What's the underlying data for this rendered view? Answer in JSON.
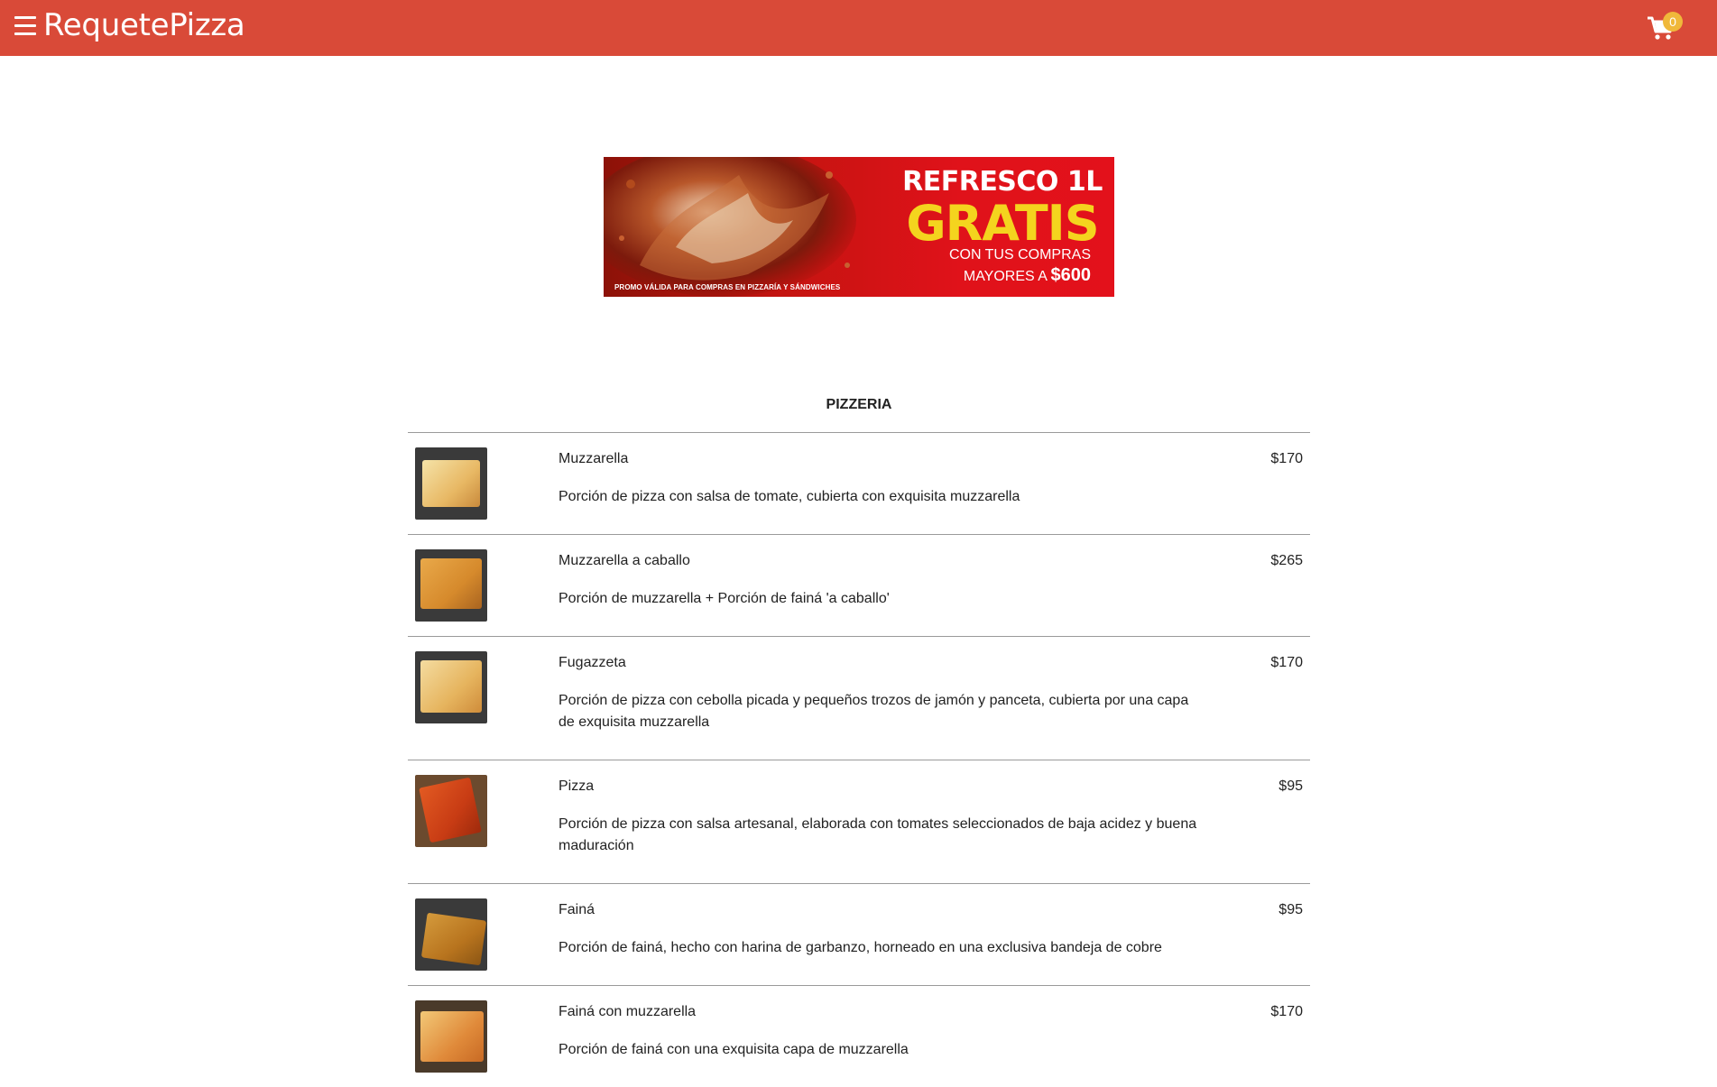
{
  "header": {
    "brand": "RequetePizza",
    "cart_count": "0",
    "colors": {
      "bar": "#d94a38",
      "badge": "#f0b83a"
    },
    "icons": [
      "hamburger-menu-icon",
      "cart-icon"
    ]
  },
  "banner": {
    "line1": "REFRESCO 1L",
    "line2": "GRATIS",
    "line3": "CON TUS COMPRAS",
    "line4": "MAYORES A",
    "amount": "$600",
    "note": "PROMO VÁLIDA PARA COMPRAS EN PIZZARÍA Y SÁNDWICHES"
  },
  "section": {
    "title": "PIZZERIA"
  },
  "items": [
    {
      "name": "Muzzarella",
      "desc": "Porción de pizza con salsa de tomate, cubierta con exquisita muzzarella",
      "price": "$170"
    },
    {
      "name": "Muzzarella a caballo",
      "desc": "Porción de muzzarella + Porción de fainá 'a caballo'",
      "price": "$265"
    },
    {
      "name": "Fugazzeta",
      "desc": "Porción de pizza con cebolla picada y pequeños trozos de jamón y panceta, cubierta por una capa de exquisita muzzarella",
      "price": "$170"
    },
    {
      "name": "Pizza",
      "desc": "Porción de pizza con salsa artesanal, elaborada con tomates seleccionados de baja acidez y buena maduración",
      "price": "$95"
    },
    {
      "name": "Fainá",
      "desc": "Porción de fainá, hecho con harina de garbanzo, horneado en una exclusiva bandeja de cobre",
      "price": "$95"
    },
    {
      "name": "Fainá con muzzarella",
      "desc": "Porción de fainá con una exquisita capa de muzzarella",
      "price": "$170"
    }
  ]
}
